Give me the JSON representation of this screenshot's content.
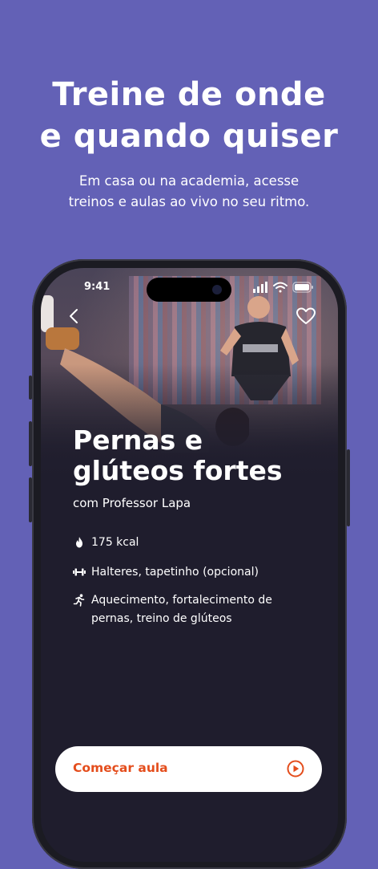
{
  "headline": {
    "line1": "Treine de onde",
    "line2": "e quando quiser"
  },
  "subheadline": {
    "line1": "Em casa ou na academia, acesse",
    "line2": "treinos e aulas ao vivo no seu ritmo."
  },
  "phone": {
    "status_bar": {
      "time": "9:41"
    },
    "workout": {
      "title_line1": "Pernas e",
      "title_line2": "glúteos fortes",
      "instructor": "com Professor Lapa",
      "details": [
        {
          "icon": "flame-icon",
          "text": "175 kcal"
        },
        {
          "icon": "dumbbell-icon",
          "text": "Halteres, tapetinho (opcional)"
        },
        {
          "icon": "running-icon",
          "text_line1": "Aquecimento, fortalecimento de",
          "text_line2": "pernas, treino de glúteos"
        }
      ]
    },
    "cta": {
      "label": "Começar aula",
      "icon": "play-circle-icon"
    }
  },
  "colors": {
    "background": "#6361b6",
    "screen": "#1f1d2d",
    "accent": "#e44d1c"
  }
}
